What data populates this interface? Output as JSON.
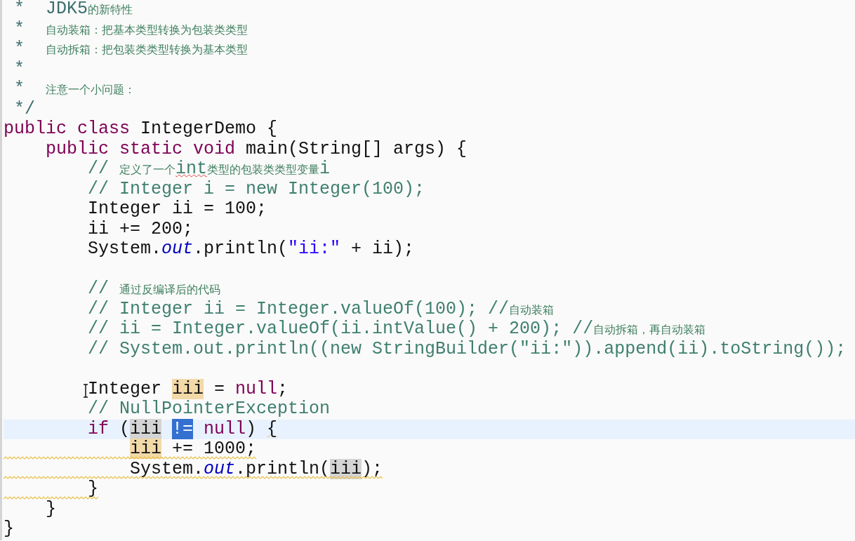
{
  "editor": {
    "lines": [
      {
        "tokens": [
          {
            "text": " *  JDK5",
            "kind": "javadoc"
          },
          {
            "text": "的新特性",
            "kind": "javadoc_cjk"
          }
        ]
      },
      {
        "tokens": [
          {
            "text": " *  ",
            "kind": "javadoc"
          },
          {
            "text": "自动装箱：把基本类型转换为包装类类型",
            "kind": "javadoc_cjk"
          }
        ]
      },
      {
        "tokens": [
          {
            "text": " *  ",
            "kind": "javadoc"
          },
          {
            "text": "自动拆箱：把包装类类型转换为基本类型",
            "kind": "javadoc_cjk"
          }
        ]
      },
      {
        "tokens": [
          {
            "text": " *",
            "kind": "javadoc"
          }
        ]
      },
      {
        "tokens": [
          {
            "text": " *  ",
            "kind": "javadoc"
          },
          {
            "text": "注意一个小问题：",
            "kind": "javadoc_cjk"
          }
        ]
      },
      {
        "tokens": [
          {
            "text": " */",
            "kind": "javadoc"
          }
        ]
      },
      {
        "tokens": [
          {
            "text": "public class",
            "kind": "keyword"
          },
          {
            "text": " IntegerDemo {",
            "kind": "plain"
          }
        ]
      },
      {
        "tokens": [
          {
            "text": "    public static void",
            "kind": "keyword"
          },
          {
            "text": " main(String[] args) {",
            "kind": "plain"
          }
        ]
      },
      {
        "tokens": [
          {
            "text": "        // ",
            "kind": "comment"
          },
          {
            "text": "定义了一个",
            "kind": "comment_cjk"
          },
          {
            "text": "int",
            "kind": "comment",
            "spelling": true
          },
          {
            "text": "类型的包装类类型变量",
            "kind": "comment_cjk"
          },
          {
            "text": "i",
            "kind": "comment"
          }
        ]
      },
      {
        "tokens": [
          {
            "text": "        // Integer i = new Integer(100);",
            "kind": "comment"
          }
        ]
      },
      {
        "tokens": [
          {
            "text": "        Integer ii = 100;",
            "kind": "plain"
          }
        ]
      },
      {
        "tokens": [
          {
            "text": "        ii += 200;",
            "kind": "plain"
          }
        ]
      },
      {
        "tokens": [
          {
            "text": "        System.",
            "kind": "plain"
          },
          {
            "text": "out",
            "kind": "field"
          },
          {
            "text": ".println(",
            "kind": "plain"
          },
          {
            "text": "\"ii:\"",
            "kind": "string"
          },
          {
            "text": " + ii);",
            "kind": "plain"
          }
        ]
      },
      {
        "blank_line_before": true,
        "tokens": [
          {
            "text": "        // ",
            "kind": "comment"
          },
          {
            "text": "通过反编译后的代码",
            "kind": "comment_cjk"
          }
        ]
      },
      {
        "tokens": [
          {
            "text": "        // Integer ii = Integer.valueOf(100); //",
            "kind": "comment"
          },
          {
            "text": "自动装箱",
            "kind": "comment_cjk"
          }
        ]
      },
      {
        "tokens": [
          {
            "text": "        // ii = Integer.valueOf(ii.intValue() + 200); //",
            "kind": "comment"
          },
          {
            "text": "自动拆箱，再自动装箱",
            "kind": "comment_cjk"
          }
        ]
      },
      {
        "tokens": [
          {
            "text": "        // System.out.println((new StringBuilder(\"ii:\")).append(ii).toString());",
            "kind": "comment"
          }
        ]
      },
      {
        "blank_line_before": true,
        "mouse_cursor": true,
        "tokens": [
          {
            "text": "        Integer ",
            "kind": "plain"
          },
          {
            "text": "iii",
            "kind": "write_occurrence"
          },
          {
            "text": " = ",
            "kind": "plain"
          },
          {
            "text": "null",
            "kind": "keyword"
          },
          {
            "text": ";",
            "kind": "plain"
          }
        ]
      },
      {
        "tokens": [
          {
            "text": "        // NullPointerException",
            "kind": "comment"
          }
        ]
      },
      {
        "current": true,
        "tokens": [
          {
            "text": "        if",
            "kind": "keyword"
          },
          {
            "text": " (",
            "kind": "plain"
          },
          {
            "text": "iii",
            "kind": "read_occurrence",
            "gap_after": true
          },
          {
            "text": "!=",
            "kind": "selection",
            "gap_after": true
          },
          {
            "text": "null",
            "kind": "keyword"
          },
          {
            "text": ") ",
            "kind": "plain"
          },
          {
            "text": "{",
            "kind": "plain",
            "warning": true
          }
        ],
        "children": [
          {
            "warning": true,
            "tokens": [
              {
                "text": "iii",
                "kind": "write_occurrence"
              },
              {
                "text": " += 1000;",
                "kind": "plain"
              }
            ]
          },
          {
            "warning": true,
            "tokens": [
              {
                "text": "System.",
                "kind": "plain"
              },
              {
                "text": "out",
                "kind": "field"
              },
              {
                "text": ".println(",
                "kind": "plain"
              },
              {
                "text": "iii",
                "kind": "read_occurrence"
              },
              {
                "text": ");",
                "kind": "plain"
              }
            ]
          }
        ]
      },
      {
        "warning": true,
        "tokens": [
          {
            "text": "        }",
            "kind": "plain"
          }
        ]
      },
      {
        "tokens": [
          {
            "text": "    }",
            "kind": "plain"
          }
        ]
      },
      {
        "tokens": [
          {
            "text": "}",
            "kind": "plain"
          }
        ]
      }
    ]
  }
}
